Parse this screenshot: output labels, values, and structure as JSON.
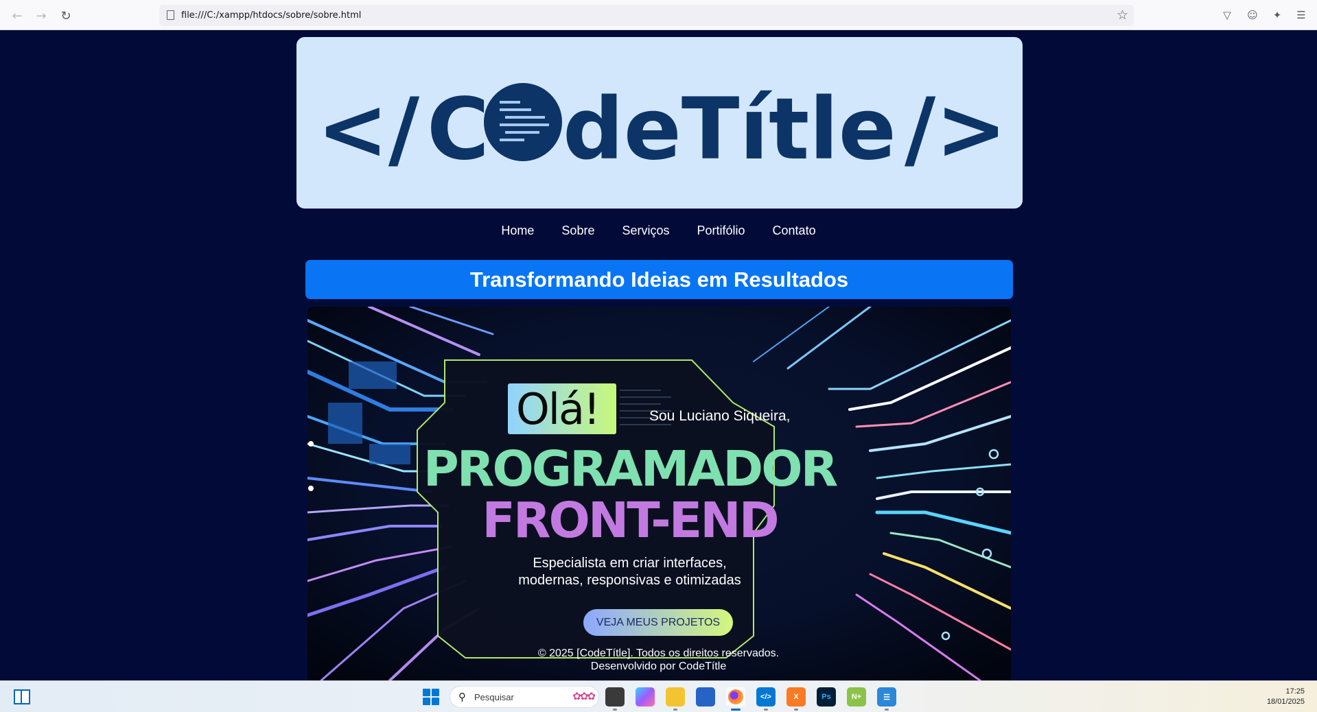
{
  "browser": {
    "url": "file:///C:/xampp/htdocs/sobre/sobre.html"
  },
  "logo": {
    "left_tag": "</",
    "text_c": "C",
    "text_rest": "deTítle",
    "right_tag": "/>"
  },
  "nav": {
    "items": [
      {
        "label": "Home"
      },
      {
        "label": "Sobre"
      },
      {
        "label": "Serviços"
      },
      {
        "label": "Portifólio"
      },
      {
        "label": "Contato"
      }
    ]
  },
  "hero": {
    "title": "Transformando Ideias em Resultados",
    "image": {
      "greeting": "Olá!",
      "intro": "Sou Luciano Siqueira,",
      "headline_1": "PROGRAMADOR",
      "headline_2": "FRONT-END",
      "description_1": "Especialista em criar interfaces,",
      "description_2": "modernas, responsivas e otimizadas",
      "cta": "VEJA MEUS PROJETOS"
    }
  },
  "footer": {
    "copyright": "© 2025 [CodeTítle]. Todos os direitos reservados.",
    "credit": "Desenvolvido por CodeTítle"
  },
  "taskbar": {
    "search_placeholder": "Pesquisar",
    "apps": [
      {
        "icon": "file-explorer-icon",
        "color": "#f2b01e"
      },
      {
        "icon": "copilot-icon",
        "color": "#7b61ff"
      },
      {
        "icon": "folder-icon",
        "color": "#f4c430"
      },
      {
        "icon": "store-icon",
        "color": "#2563c7"
      },
      {
        "icon": "firefox-icon",
        "color": "#ff7139"
      },
      {
        "icon": "vscode-icon",
        "color": "#0078d4"
      },
      {
        "icon": "xampp-icon",
        "color": "#fb7a24"
      },
      {
        "icon": "photoshop-icon",
        "color": "#001e36"
      },
      {
        "icon": "notepad-plus-icon",
        "color": "#8bc34a"
      },
      {
        "icon": "notepad-icon",
        "color": "#2b88d8"
      }
    ],
    "time": "17:25",
    "date": "18/01/2025"
  },
  "colors": {
    "page_bg": "#020b38",
    "logo_bg": "#d3e7fc",
    "logo_fg": "#0d3466",
    "banner_bg": "#0a75f4"
  }
}
